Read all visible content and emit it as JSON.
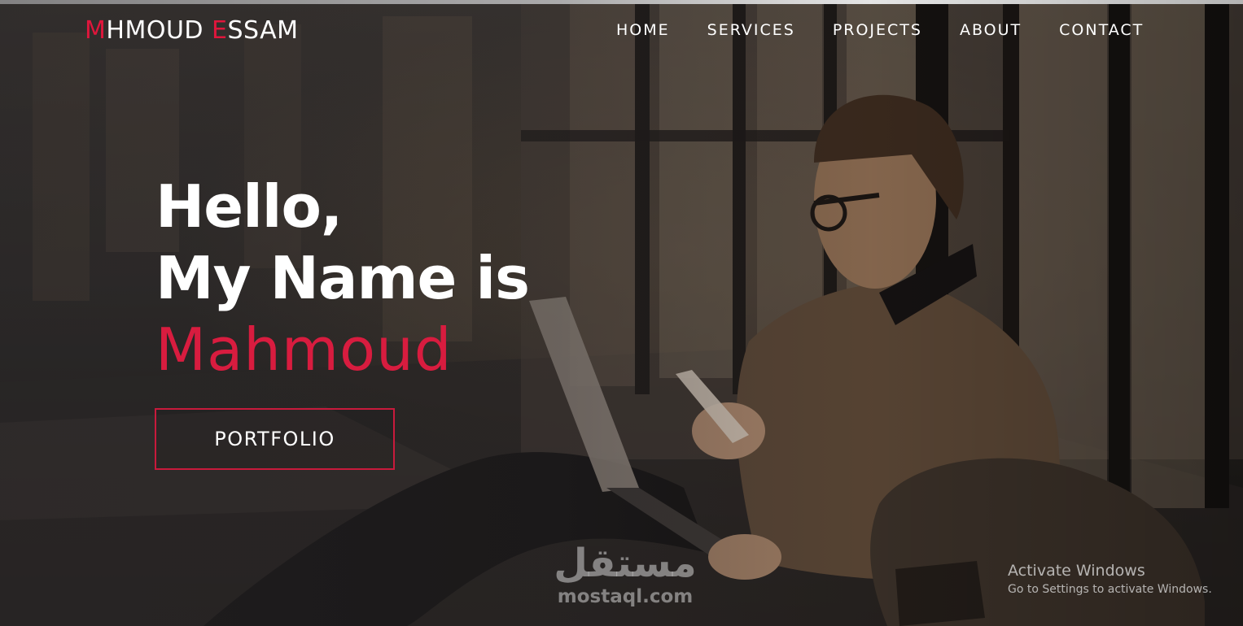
{
  "brand": {
    "first_initial": "M",
    "first_rest": "HMOUD ",
    "last_initial": "E",
    "last_rest": "SSAM",
    "accent_color": "#e0163c"
  },
  "nav": {
    "items": [
      "HOME",
      "SERVICES",
      "PROJECTS",
      "ABOUT",
      "CONTACT"
    ]
  },
  "hero": {
    "line1": "Hello,",
    "line2": "My Name is",
    "name": "Mahmoud",
    "cta_label": "PORTFOLIO"
  },
  "watermark": {
    "arabic": "مستقل",
    "domain": "mostaql.com"
  },
  "activate_windows": {
    "title": "Activate Windows",
    "subtitle": "Go to Settings to activate Windows."
  }
}
